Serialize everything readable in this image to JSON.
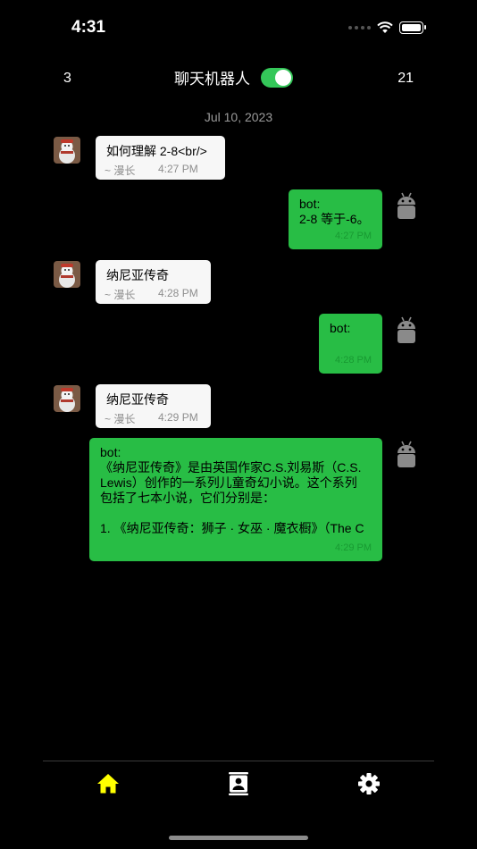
{
  "status_bar": {
    "time": "4:31"
  },
  "nav": {
    "left_count": "3",
    "title": "聊天机器人",
    "toggle_on": true,
    "right_count": "21"
  },
  "chat": {
    "date": "Jul 10, 2023",
    "messages": [
      {
        "from": "user",
        "text": "如何理解 2-8<br/>",
        "author": "~ 漫长",
        "time": "4:27 PM"
      },
      {
        "from": "bot",
        "lines": [
          "bot:",
          "2-8 等于-6。"
        ],
        "time": "4:27 PM"
      },
      {
        "from": "user",
        "text": "纳尼亚传奇",
        "author": "~ 漫长",
        "time": "4:28 PM"
      },
      {
        "from": "bot",
        "lines": [
          "bot:"
        ],
        "time": "4:28 PM"
      },
      {
        "from": "user",
        "text": "纳尼亚传奇",
        "author": "~ 漫长",
        "time": "4:29 PM"
      },
      {
        "from": "bot",
        "lines": [
          "bot:",
          "《纳尼亚传奇》是由英国作家C.S.刘易斯（C.S.",
          "Lewis）创作的一系列儿童奇幻小说。这个系列",
          "包括了七本小说，它们分别是：",
          "",
          "1. 《纳尼亚传奇：狮子 · 女巫 · 魔衣橱》（The C"
        ],
        "time": "4:29 PM"
      }
    ]
  },
  "tab_bar": {
    "items": [
      {
        "name": "home",
        "icon": "home-icon",
        "active": true
      },
      {
        "name": "contacts",
        "icon": "contact-book-icon",
        "active": false
      },
      {
        "name": "settings",
        "icon": "gear-icon",
        "active": false
      }
    ]
  },
  "colors": {
    "accent": "#34c759",
    "bot_bubble": "#28bd45",
    "active_tab": "#ffff00"
  }
}
